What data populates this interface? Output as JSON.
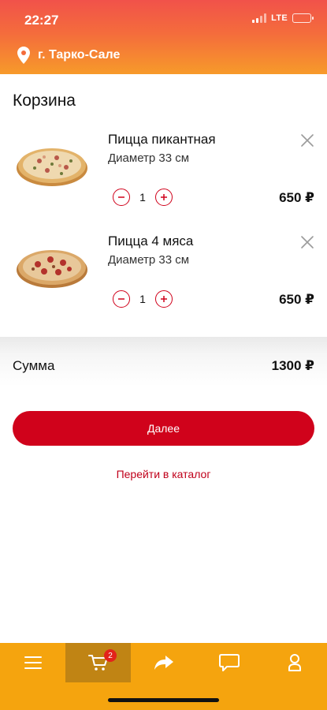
{
  "status_bar": {
    "time": "22:27",
    "network": "LTE"
  },
  "header": {
    "location": "г. Тарко-Сале",
    "icon": "location-pin-icon"
  },
  "page": {
    "title": "Корзина"
  },
  "cart_items": [
    {
      "name": "Пицца пикантная",
      "description": "Диаметр 33 см",
      "quantity": "1",
      "price": "650 ₽",
      "icon": "close-icon"
    },
    {
      "name": "Пицца 4 мяса",
      "description": "Диаметр 33 см",
      "quantity": "1",
      "price": "650 ₽",
      "icon": "close-icon"
    }
  ],
  "summary": {
    "label": "Сумма",
    "value": "1300 ₽"
  },
  "actions": {
    "next_label": "Далее",
    "catalog_link": "Перейти в каталог"
  },
  "bottom_nav": {
    "items": [
      "menu-icon",
      "cart-icon",
      "share-icon",
      "chat-icon",
      "profile-icon"
    ],
    "cart_badge": "2",
    "active_index": 1
  },
  "colors": {
    "accent": "#d0021b",
    "nav_bg": "#f5a40e",
    "nav_active": "#c08414",
    "header_top": "#f1524a",
    "header_bottom": "#f79a2a"
  }
}
